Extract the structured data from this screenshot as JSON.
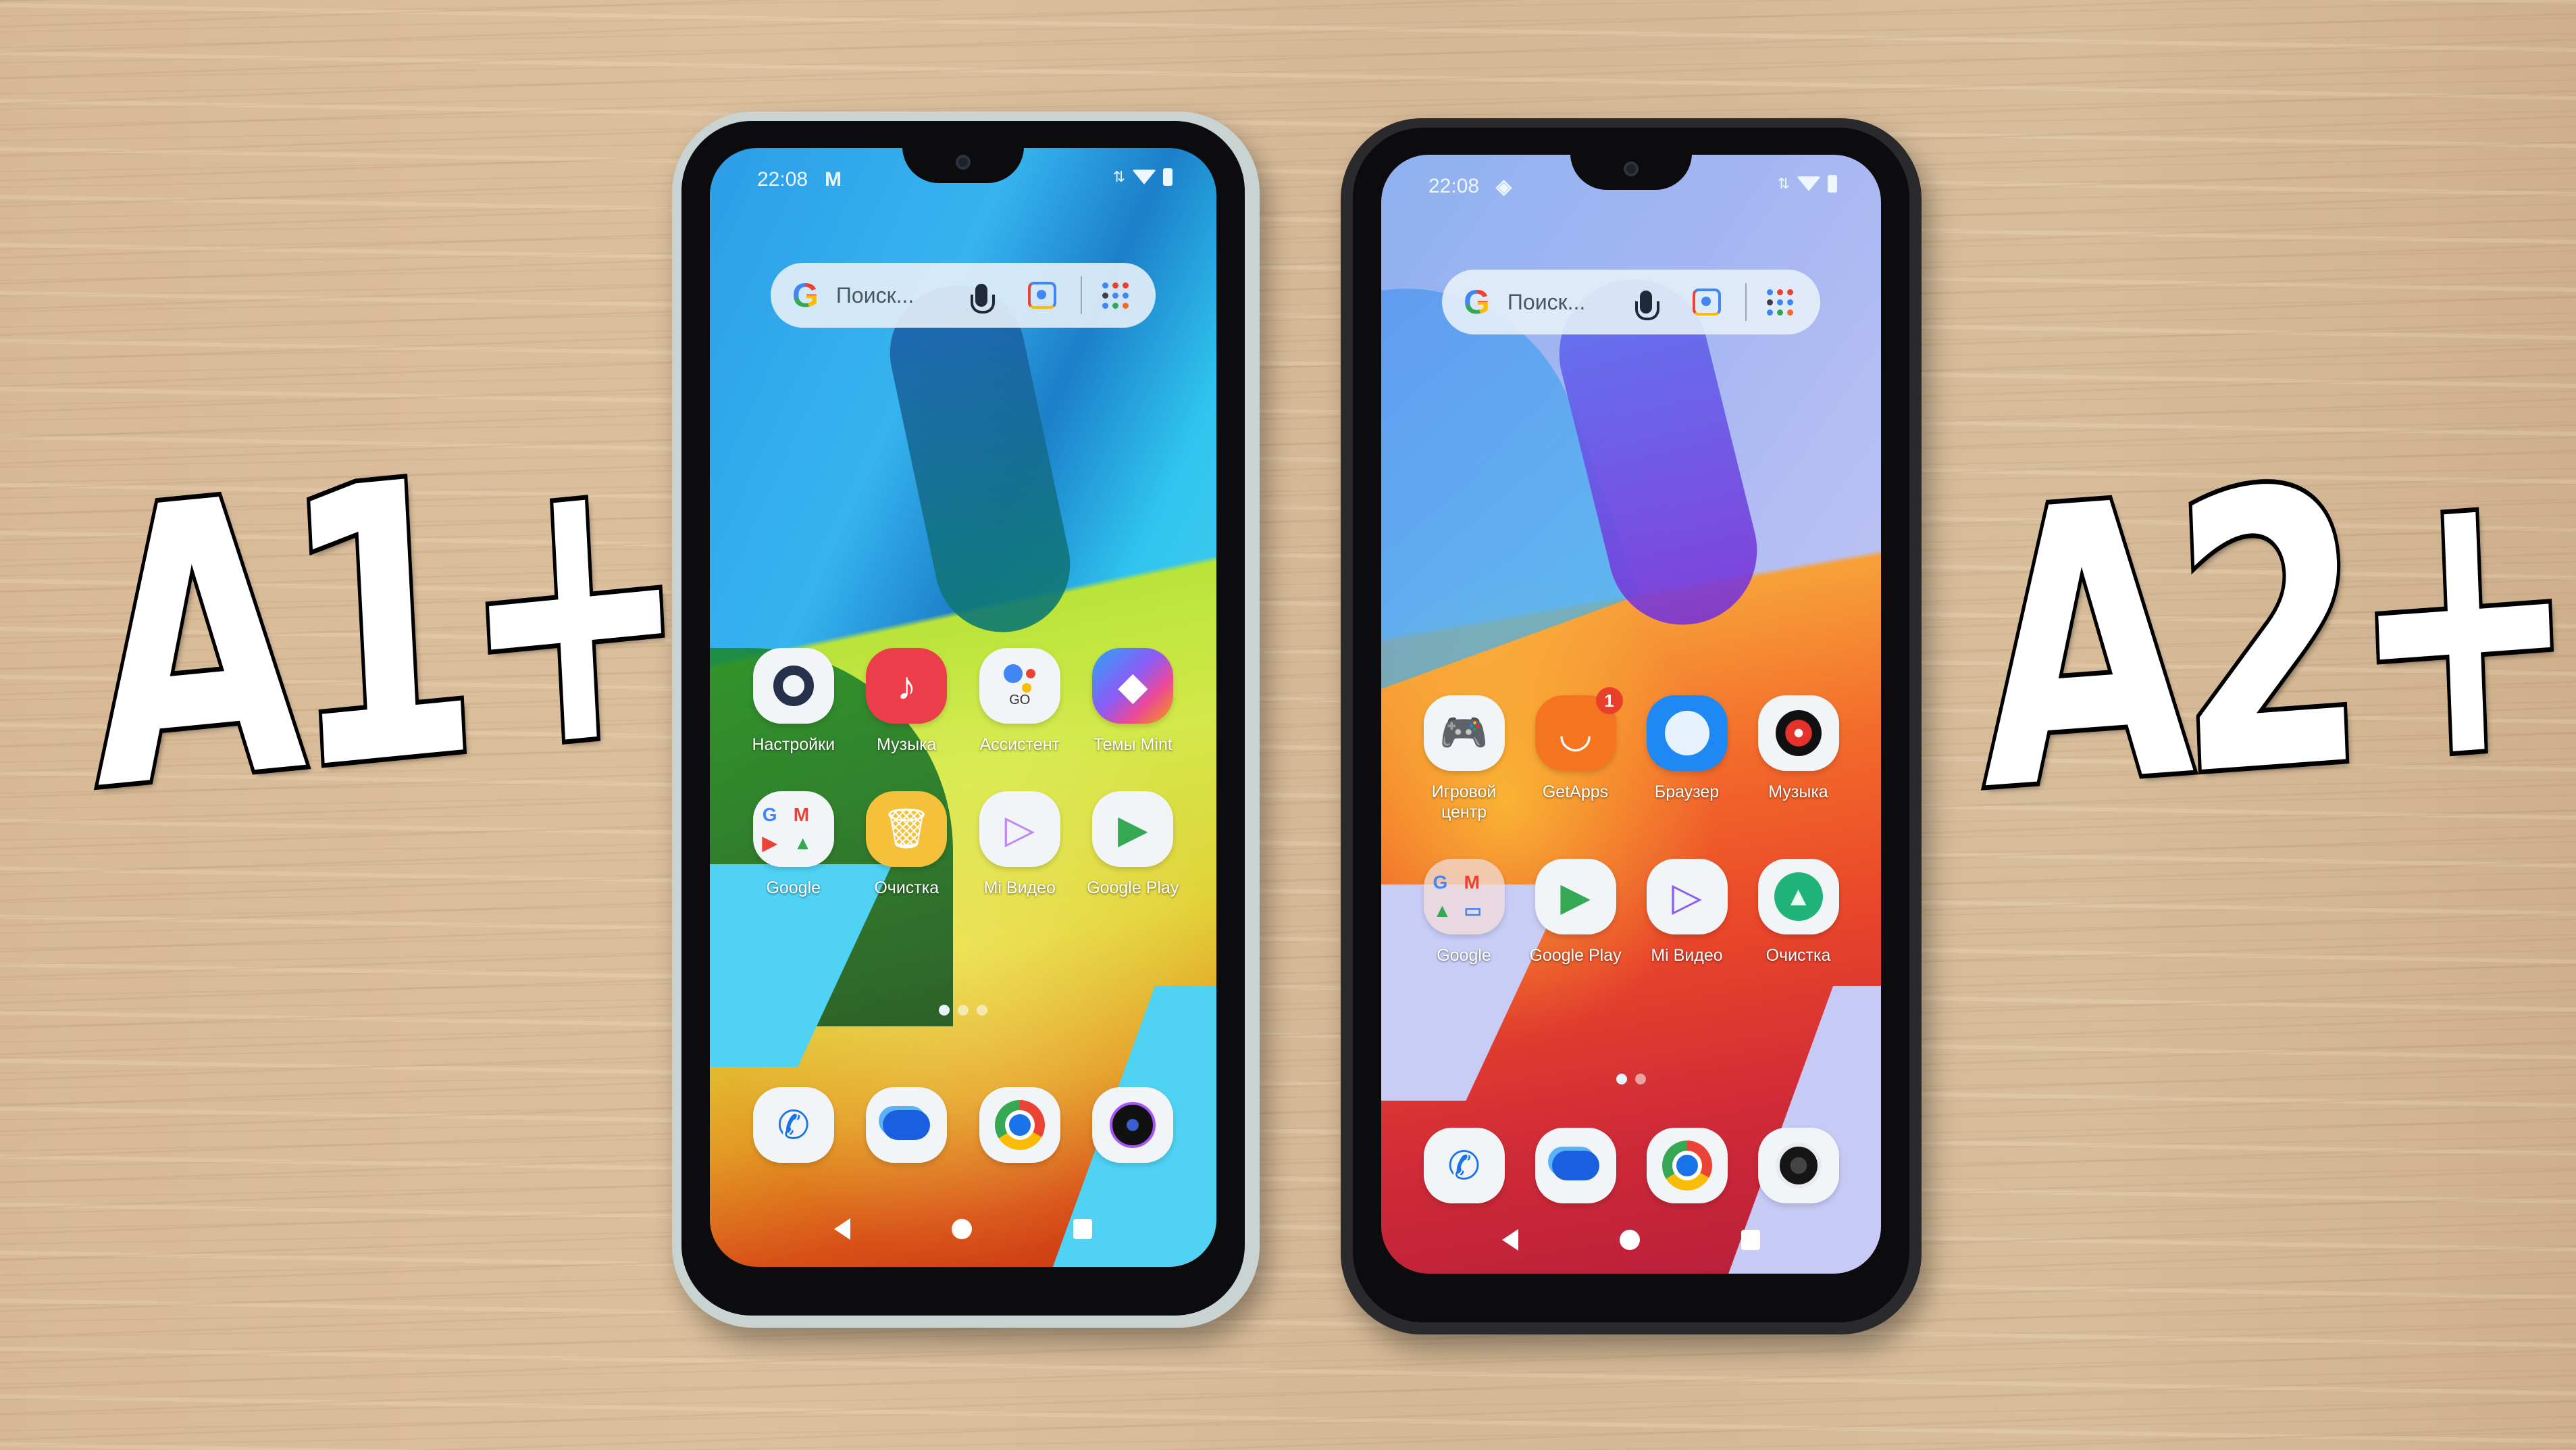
{
  "overlay": {
    "left_label": "A1+",
    "right_label": "A2+"
  },
  "phones": [
    {
      "model": "A1+",
      "status_bar": {
        "time": "22:08",
        "notification_icon": "gmail-icon"
      },
      "search": {
        "placeholder": "Поиск..."
      },
      "apps": [
        {
          "label": "Настройки",
          "icon": "settings-icon"
        },
        {
          "label": "Музыка",
          "icon": "music-icon"
        },
        {
          "label": "Ассистент",
          "icon": "assistant-go-icon",
          "icon_text": "GO"
        },
        {
          "label": "Темы Mint",
          "icon": "themes-icon"
        },
        {
          "label": "Google",
          "icon": "google-folder-icon"
        },
        {
          "label": "Очистка",
          "icon": "cleaner-icon"
        },
        {
          "label": "Mi Видео",
          "icon": "mi-video-icon"
        },
        {
          "label": "Google Play",
          "icon": "play-store-icon"
        }
      ],
      "page_indicator": {
        "pages": 3,
        "current": 1
      },
      "dock": [
        {
          "icon": "phone-icon"
        },
        {
          "icon": "messages-icon"
        },
        {
          "icon": "chrome-icon"
        },
        {
          "icon": "camera-icon"
        }
      ]
    },
    {
      "model": "A2+",
      "status_bar": {
        "time": "22:08",
        "notification_icon": "app-notification-icon"
      },
      "search": {
        "placeholder": "Поиск..."
      },
      "apps": [
        {
          "label": "Игровой центр",
          "icon": "game-center-icon"
        },
        {
          "label": "GetApps",
          "icon": "getapps-icon",
          "badge": "1"
        },
        {
          "label": "Браузер",
          "icon": "browser-icon"
        },
        {
          "label": "Музыка",
          "icon": "music-icon"
        },
        {
          "label": "Google",
          "icon": "google-folder-icon"
        },
        {
          "label": "Google Play",
          "icon": "play-store-icon"
        },
        {
          "label": "Mi Видео",
          "icon": "mi-video-icon"
        },
        {
          "label": "Очистка",
          "icon": "cleaner-icon"
        }
      ],
      "page_indicator": {
        "pages": 2,
        "current": 1
      },
      "dock": [
        {
          "icon": "phone-icon"
        },
        {
          "icon": "messages-icon"
        },
        {
          "icon": "chrome-icon"
        },
        {
          "icon": "camera-icon"
        }
      ]
    }
  ]
}
